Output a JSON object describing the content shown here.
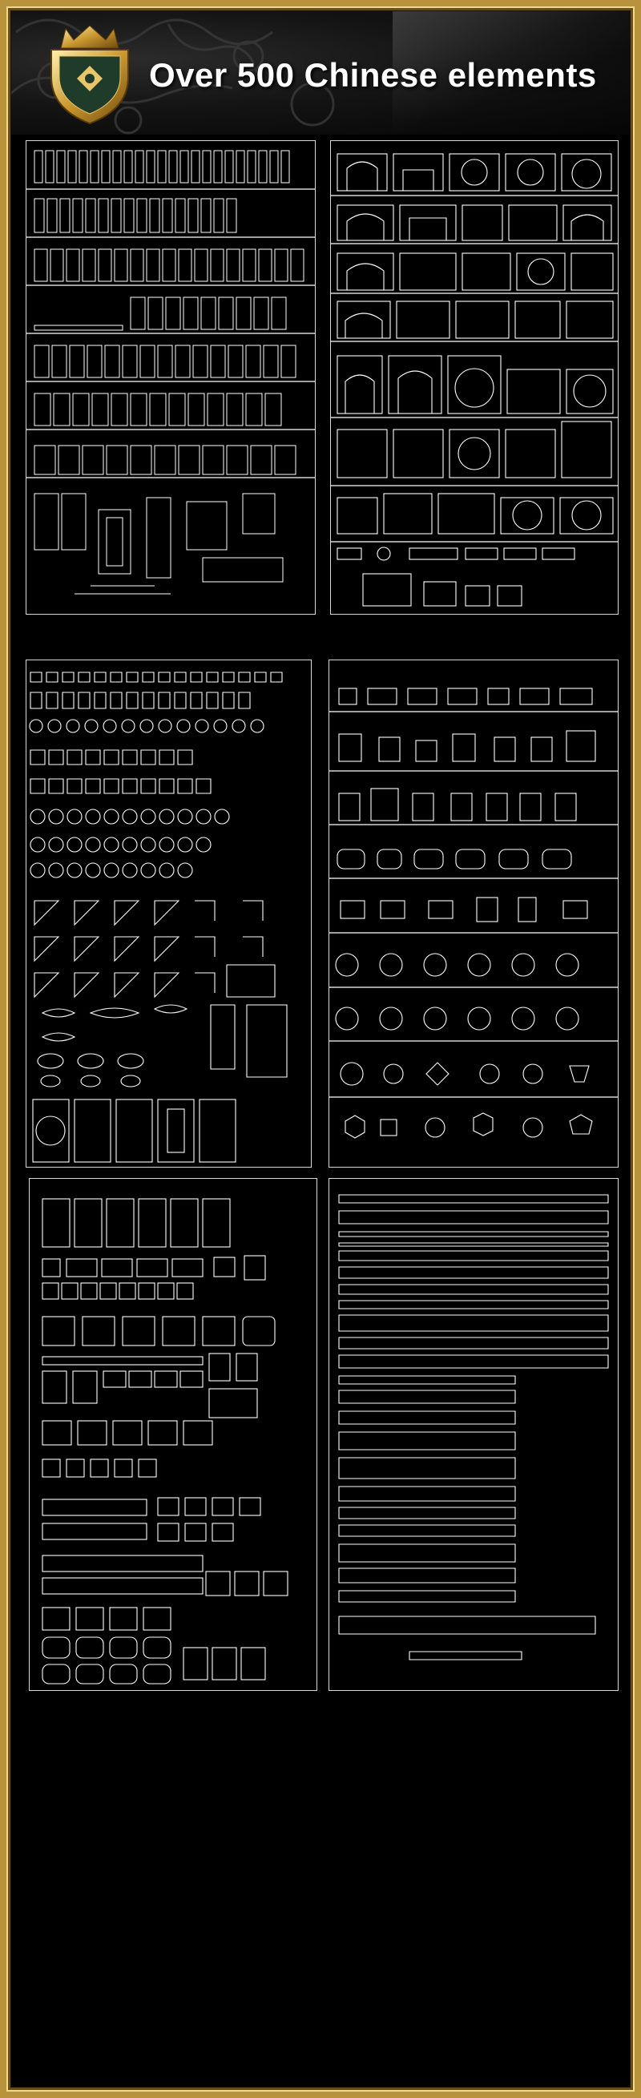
{
  "title": "Over 500 Chinese elements",
  "colors": {
    "frame_gold": "#b8923c",
    "background": "#000000",
    "linework": "#ffffff"
  },
  "icons": {
    "crest": "crown-shield-crest-icon"
  },
  "panels": [
    {
      "name": "chinese-doors-and-windows-panel",
      "content": "door-and-window-drawings"
    },
    {
      "name": "chinese-arches-and-screens-panel",
      "content": "arch-and-screen-drawings"
    },
    {
      "name": "chinese-ornaments-panel",
      "content": "ornament-and-bracket-drawings"
    },
    {
      "name": "chinese-lattice-windows-panel",
      "content": "lattice-window-drawings"
    },
    {
      "name": "chinese-carved-panels-panel",
      "content": "carved-panel-drawings"
    },
    {
      "name": "chinese-fret-borders-panel",
      "content": "fret-border-drawings"
    }
  ]
}
